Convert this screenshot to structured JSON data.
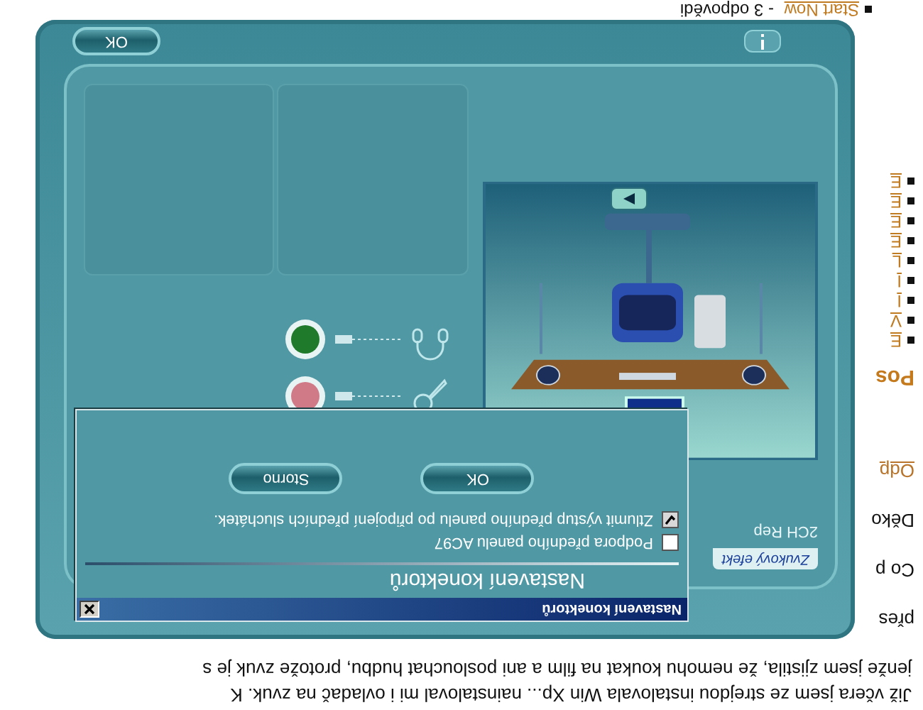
{
  "intro_text": [
    "Již včera jsem ze strejdou instalovala Win Xp... nainstaloval mi i ovladač na zvuk. K",
    "jenže jsem zjistila, že nemohu koukat na film a ani poslouchat hudbu, protože zvuk je s"
  ],
  "page_fragments": [
    {
      "kind": "text",
      "text": "přes"
    },
    {
      "kind": "text",
      "text": "Co p"
    },
    {
      "kind": "text",
      "text": "Děko"
    },
    {
      "kind": "link",
      "text": "Odp"
    },
    {
      "kind": "heading",
      "text": "Pos"
    }
  ],
  "bullet_list": [
    "E",
    "V",
    "I",
    "I",
    "L",
    "E",
    "E",
    "E",
    "E"
  ],
  "last_item": {
    "link": "Start Now",
    "text": " - 3 odpovědi"
  },
  "panel": {
    "tab": "Zvukový efekt",
    "mode_label": "2CH Rep",
    "connectors": [
      {
        "kind": "microphone",
        "color": "#d07a88"
      },
      {
        "kind": "headphones",
        "color": "#1f7a2c"
      }
    ],
    "ok_button": "OK"
  },
  "dialog": {
    "title": "Nastavení konektorů",
    "heading": "Nastavení konektorů",
    "options": [
      {
        "label": "Podpora předního panelu AC97",
        "checked": false
      },
      {
        "label": "Ztlumit výstup předního panelu po připojení předních sluchátek.",
        "checked": true
      }
    ],
    "buttons": [
      "OK",
      "Storno"
    ]
  }
}
